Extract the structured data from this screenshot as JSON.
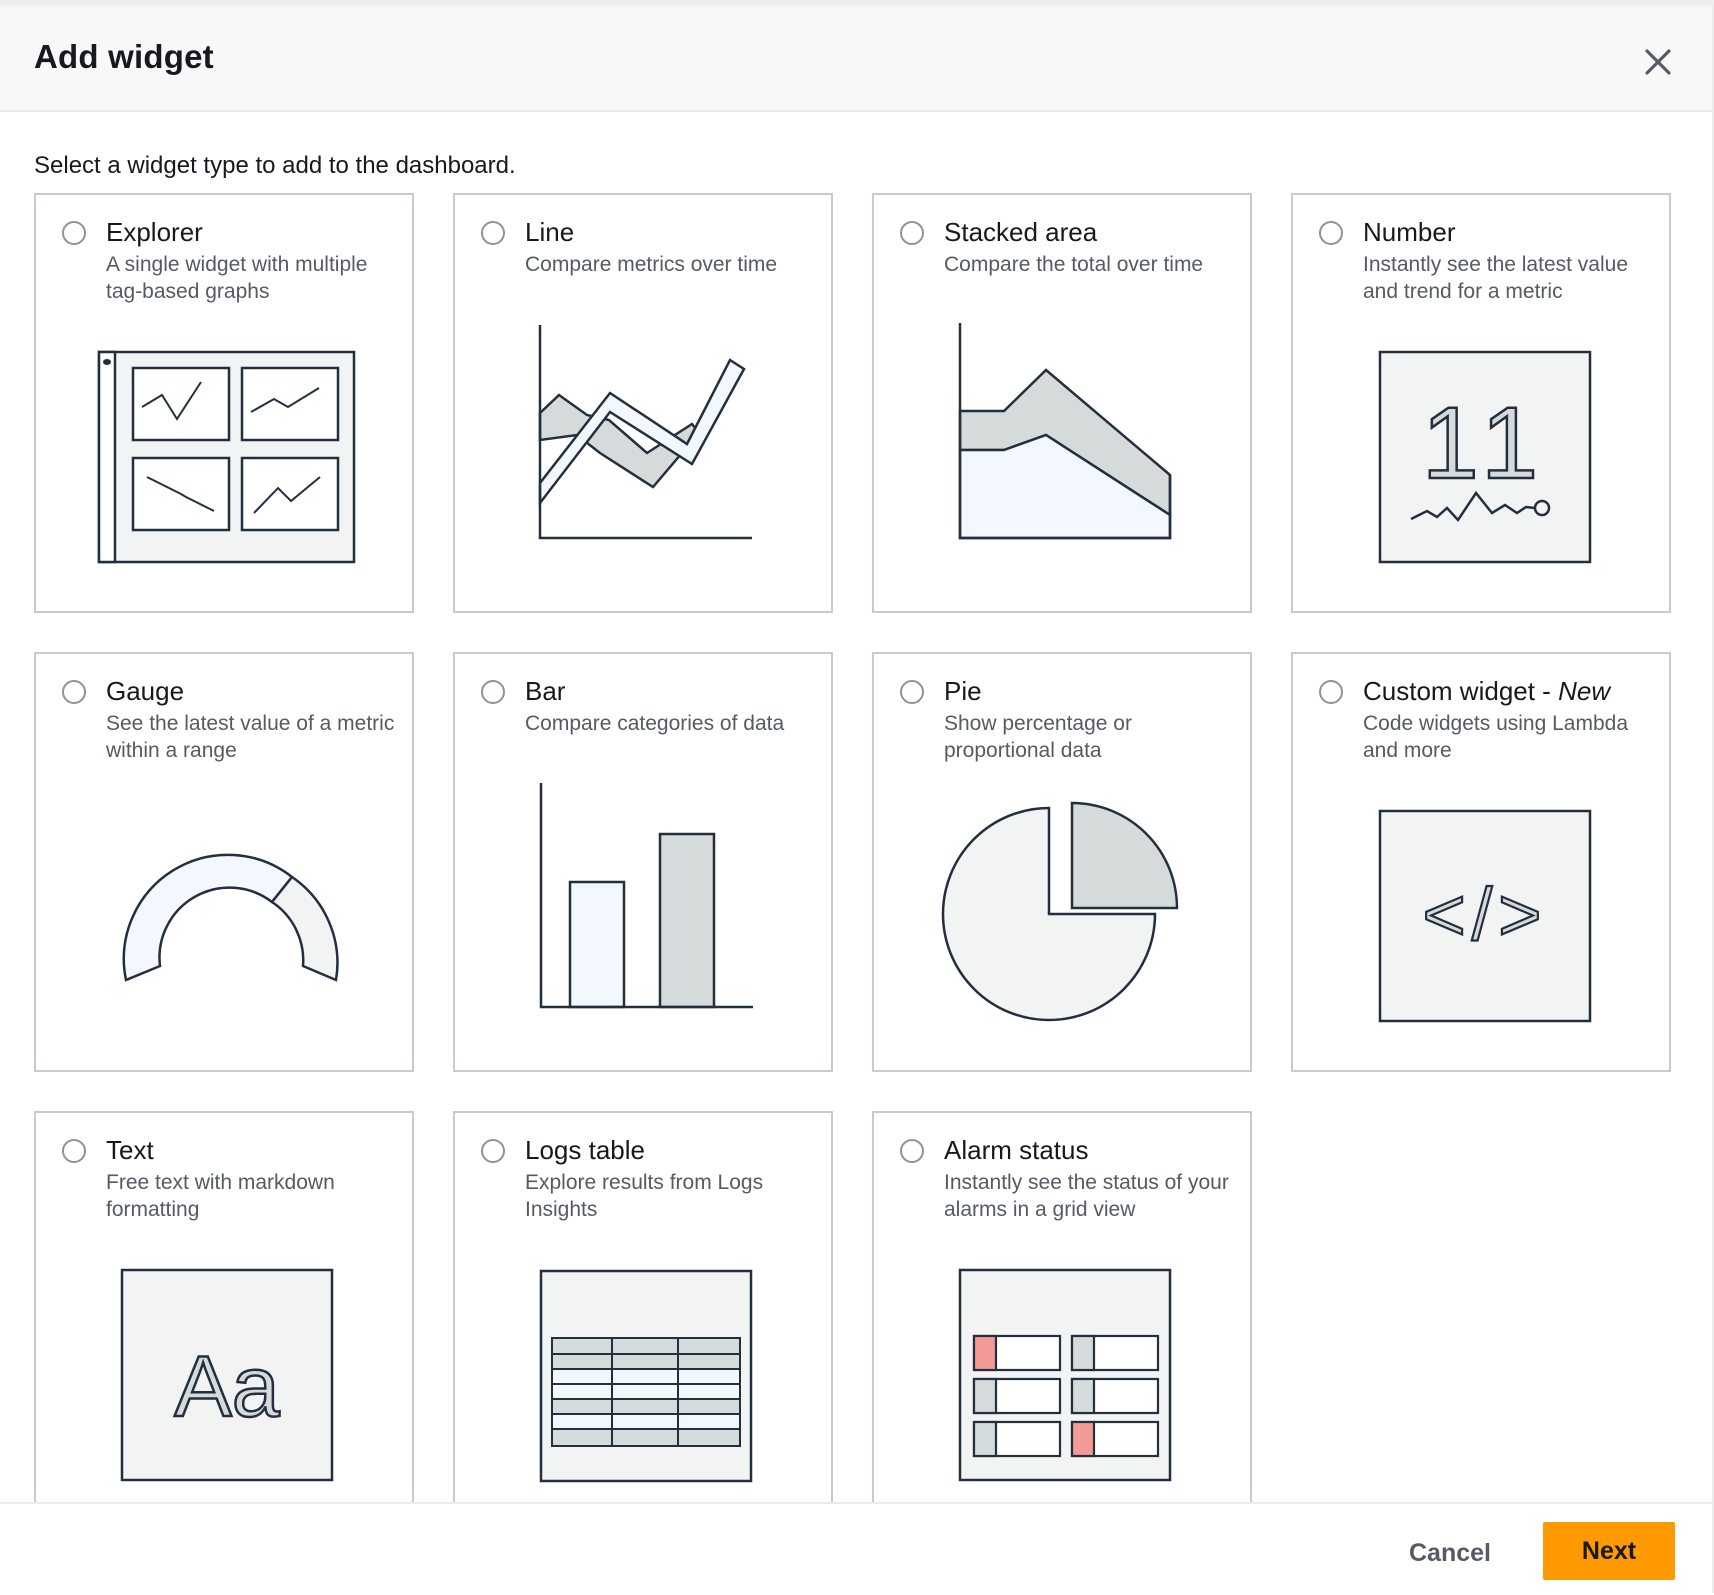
{
  "dialog": {
    "title": "Add widget",
    "intro": "Select a widget type to add to the dashboard."
  },
  "widgets": [
    {
      "title": "Explorer",
      "desc": "A single widget with multiple tag-based graphs",
      "icon": "explorer-icon"
    },
    {
      "title": "Line",
      "desc": "Compare metrics over time",
      "icon": "line-chart-icon"
    },
    {
      "title": "Stacked area",
      "desc": "Compare the total over time",
      "icon": "stacked-area-icon"
    },
    {
      "title": "Number",
      "desc": "Instantly see the latest value and trend for a metric",
      "icon": "number-icon",
      "sample_value": "11"
    },
    {
      "title": "Gauge",
      "desc": "See the latest value of a metric within a range",
      "icon": "gauge-icon"
    },
    {
      "title": "Bar",
      "desc": "Compare categories of data",
      "icon": "bar-chart-icon"
    },
    {
      "title": "Pie",
      "desc": "Show percentage or proportional data",
      "icon": "pie-chart-icon"
    },
    {
      "title": "Custom widget - ",
      "title_suffix": "New",
      "desc": "Code widgets using Lambda and more",
      "icon": "code-icon",
      "code_glyph": "</>"
    },
    {
      "title": "Text",
      "desc": "Free text with markdown formatting",
      "icon": "text-icon",
      "sample_text": "Aa"
    },
    {
      "title": "Logs table",
      "desc": "Explore results from Logs Insights",
      "icon": "logs-table-icon"
    },
    {
      "title": "Alarm status",
      "desc": "Instantly see the status of your alarms in a grid view",
      "icon": "alarm-status-icon"
    }
  ],
  "footer": {
    "cancel_label": "Cancel",
    "next_label": "Next"
  },
  "colors": {
    "primary_button": "#ff9900",
    "card_border": "#c7cbd1",
    "art_gray": "#d5dbdb",
    "art_light_blue": "#f2f8fd",
    "art_panel": "#f2f3f3",
    "alarm_red": "#f49a94"
  }
}
